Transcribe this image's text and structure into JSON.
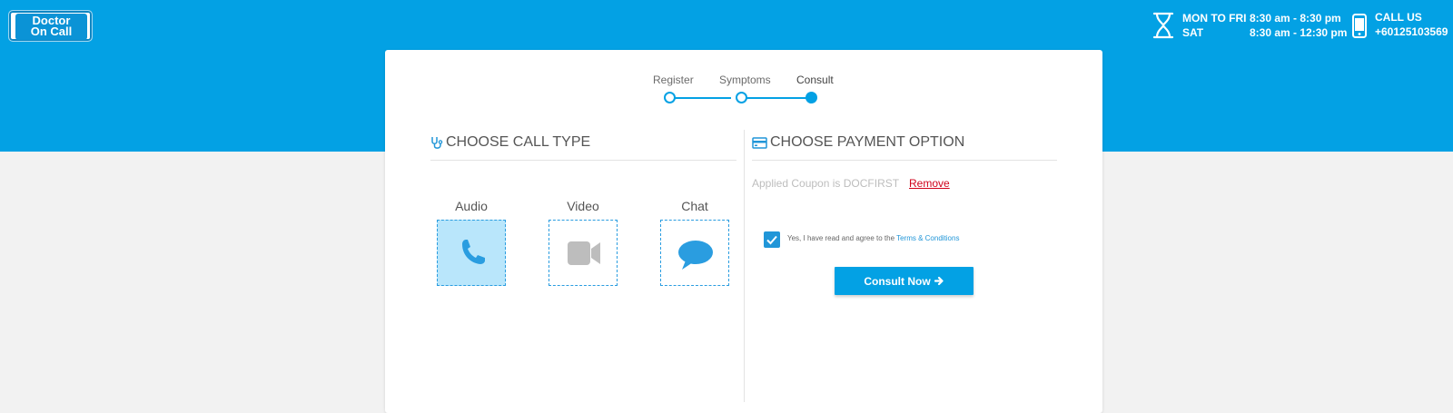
{
  "header": {
    "logo_line1": "Doctor",
    "logo_line2": "On Call",
    "hours": [
      {
        "days": "MON TO FRI",
        "time": "8:30 am - 8:30 pm"
      },
      {
        "days": "SAT",
        "time": "8:30 am - 12:30 pm"
      }
    ],
    "call_label": "CALL US",
    "call_number": "+60125103569"
  },
  "steps": [
    {
      "label": "Register",
      "state": "done"
    },
    {
      "label": "Symptoms",
      "state": "done"
    },
    {
      "label": "Consult",
      "state": "current"
    }
  ],
  "call_type": {
    "title": "CHOOSE CALL TYPE",
    "options": [
      {
        "label": "Audio",
        "icon": "phone-icon",
        "selected": true
      },
      {
        "label": "Video",
        "icon": "video-camera-icon",
        "selected": false
      },
      {
        "label": "Chat",
        "icon": "chat-bubble-icon",
        "selected": false
      }
    ]
  },
  "payment": {
    "title": "CHOOSE PAYMENT OPTION",
    "coupon_text": "Applied Coupon is DOCFIRST",
    "remove_label": "Remove",
    "agree_text": "Yes, I have read and agree to the",
    "terms_link": "Terms & Conditions",
    "agree_checked": true,
    "consult_button": "Consult Now"
  },
  "colors": {
    "brand": "#03a1e4",
    "selected_bg": "#b9e6fb",
    "remove": "#d0021b"
  }
}
